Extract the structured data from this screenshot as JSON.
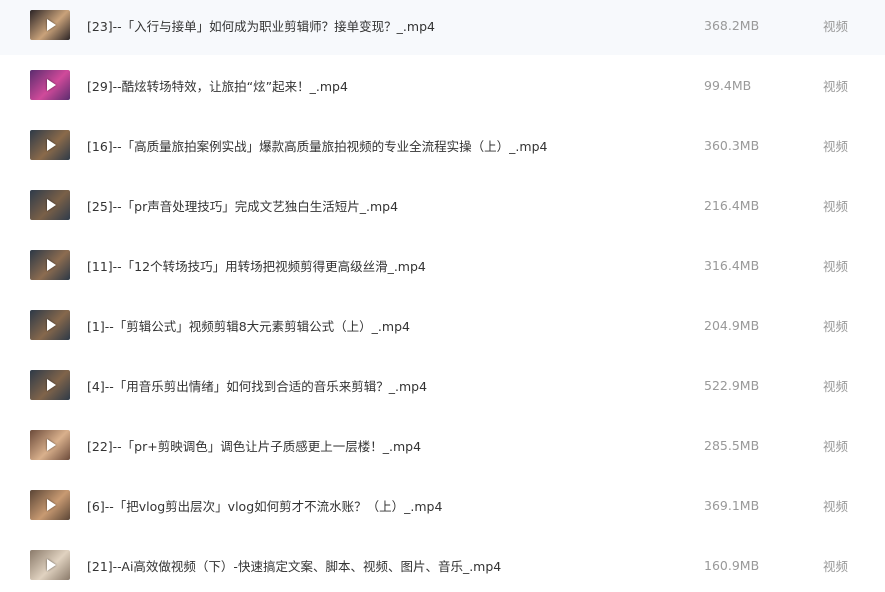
{
  "files": [
    {
      "name": "[23]--「入行与接单」如何成为职业剪辑师？接单变现？_.mp4",
      "size": "368.2MB",
      "type": "视频",
      "thumb_color": "#2b2426",
      "thumb_accent": "#c9a27a",
      "thumb_icon": "play-icon"
    },
    {
      "name": "[29]--酷炫转场特效，让旅拍“炫”起来！_.mp4",
      "size": "99.4MB",
      "type": "视频",
      "thumb_color": "#5a2c6e",
      "thumb_accent": "#d04a9a",
      "thumb_icon": "play-icon"
    },
    {
      "name": "[16]--「高质量旅拍案例实战」爆款高质量旅拍视频的专业全流程实操（上）_.mp4",
      "size": "360.3MB",
      "type": "视频",
      "thumb_color": "#2e3a48",
      "thumb_accent": "#8a6a4a",
      "thumb_icon": "play-icon"
    },
    {
      "name": "[25]--「pr声音处理技巧」完成文艺独白生活短片_.mp4",
      "size": "216.4MB",
      "type": "视频",
      "thumb_color": "#2f3b4a",
      "thumb_accent": "#7a6048",
      "thumb_icon": "play-icon"
    },
    {
      "name": "[11]--「12个转场技巧」用转场把视频剪得更高级丝滑_.mp4",
      "size": "316.4MB",
      "type": "视频",
      "thumb_color": "#2c3846",
      "thumb_accent": "#8c6c50",
      "thumb_icon": "play-icon"
    },
    {
      "name": "[1]--「剪辑公式」视频剪辑8大元素剪辑公式（上）_.mp4",
      "size": "204.9MB",
      "type": "视频",
      "thumb_color": "#2d3947",
      "thumb_accent": "#86684c",
      "thumb_icon": "play-icon"
    },
    {
      "name": "[4]--「用音乐剪出情绪」如何找到合适的音乐来剪辑？_.mp4",
      "size": "522.9MB",
      "type": "视频",
      "thumb_color": "#2e3a48",
      "thumb_accent": "#80644a",
      "thumb_icon": "play-icon"
    },
    {
      "name": "[22]--「pr+剪映调色」调色让片子质感更上一层楼！_.mp4",
      "size": "285.5MB",
      "type": "视频",
      "thumb_color": "#6b4a3a",
      "thumb_accent": "#d9b08c",
      "thumb_icon": "play-icon"
    },
    {
      "name": "[6]--「把vlog剪出层次」vlog如何剪才不流水账？（上）_.mp4",
      "size": "369.1MB",
      "type": "视频",
      "thumb_color": "#5a4536",
      "thumb_accent": "#c89a72",
      "thumb_icon": "play-icon"
    },
    {
      "name": "[21]--Ai高效做视频（下）-快速搞定文案、脚本、视频、图片、音乐_.mp4",
      "size": "160.9MB",
      "type": "视频",
      "thumb_color": "#8a7a6a",
      "thumb_accent": "#e0d2c0",
      "thumb_icon": "play-icon"
    }
  ]
}
